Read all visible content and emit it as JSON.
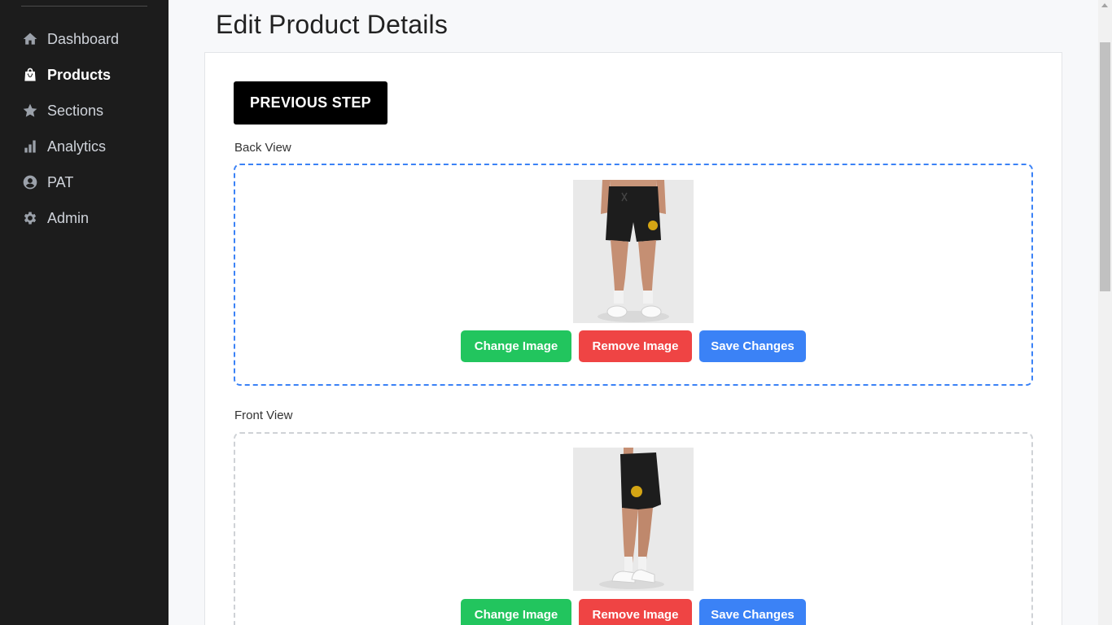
{
  "sidebar": {
    "items": [
      {
        "label": "Dashboard",
        "icon": "home-icon",
        "active": false
      },
      {
        "label": "Products",
        "icon": "shopping-bag-icon",
        "active": true
      },
      {
        "label": "Sections",
        "icon": "star-icon",
        "active": false
      },
      {
        "label": "Analytics",
        "icon": "bar-chart-icon",
        "active": false
      },
      {
        "label": "PAT",
        "icon": "user-circle-icon",
        "active": false
      },
      {
        "label": "Admin",
        "icon": "gear-icon",
        "active": false
      }
    ]
  },
  "main": {
    "title": "Edit Product Details",
    "previous_step_label": "PREVIOUS STEP",
    "views": [
      {
        "label": "Back View",
        "change_label": "Change Image",
        "remove_label": "Remove Image",
        "save_label": "Save Changes"
      },
      {
        "label": "Front View",
        "change_label": "Change Image",
        "remove_label": "Remove Image",
        "save_label": "Save Changes"
      }
    ]
  },
  "colors": {
    "sidebar_bg": "#1c1c1c",
    "accent_blue": "#3b82f6",
    "change_green": "#22c55e",
    "remove_red": "#ef4444"
  }
}
